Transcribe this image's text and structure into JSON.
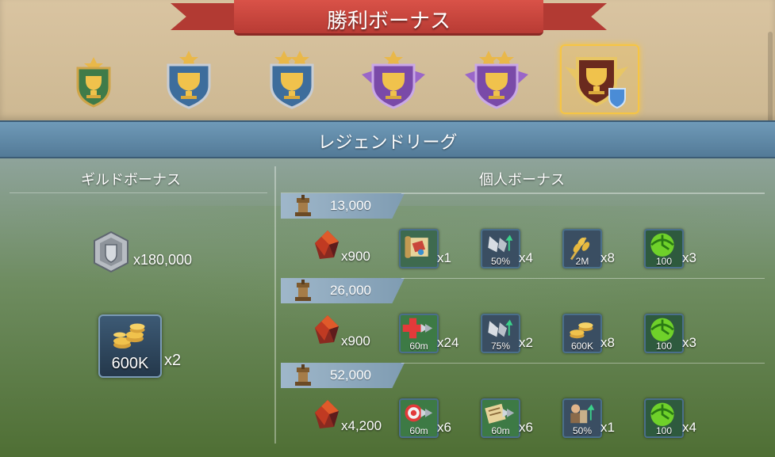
{
  "title": "勝利ボーナス",
  "league_name": "レジェンドリーグ",
  "guild_header": "ギルドボーナス",
  "personal_header": "個人ボーナス",
  "badges": [
    {
      "name": "badge-green-1star",
      "stars": 1
    },
    {
      "name": "badge-blue-1star",
      "stars": 1
    },
    {
      "name": "badge-blue-2star",
      "stars": 2
    },
    {
      "name": "badge-purple-1star",
      "stars": 1
    },
    {
      "name": "badge-purple-2star",
      "stars": 2
    },
    {
      "name": "badge-legend",
      "stars": 0,
      "selected": true
    }
  ],
  "guild_rewards": [
    {
      "icon": "guild-coin-icon",
      "qty": "x180,000"
    },
    {
      "icon": "gold-pile-icon",
      "overlay": "600K",
      "qty": "x2"
    }
  ],
  "tiers": [
    {
      "threshold": "13,000",
      "gem_qty": "x900",
      "items": [
        {
          "icon": "scroll-map-icon",
          "overlay": "",
          "qty": "x1",
          "color": "#3e6a4f"
        },
        {
          "icon": "troop-boost-icon",
          "overlay": "50%",
          "qty": "x4",
          "color": "#3a4e62"
        },
        {
          "icon": "grain-icon",
          "overlay": "2M",
          "qty": "x8",
          "color": "#3a4e62"
        },
        {
          "icon": "speedup-icon",
          "overlay": "100",
          "qty": "x3",
          "color": "#2e5a3e"
        }
      ]
    },
    {
      "threshold": "26,000",
      "gem_qty": "x900",
      "items": [
        {
          "icon": "healing-speedup-icon",
          "overlay": "60m",
          "qty": "x24",
          "color": "#3d7a45"
        },
        {
          "icon": "troop-boost-icon",
          "overlay": "75%",
          "qty": "x2",
          "color": "#3a4e62"
        },
        {
          "icon": "gold-icon",
          "overlay": "600K",
          "qty": "x8",
          "color": "#3a4e62"
        },
        {
          "icon": "speedup-icon",
          "overlay": "100",
          "qty": "x3",
          "color": "#2e5a3e"
        }
      ]
    },
    {
      "threshold": "52,000",
      "gem_qty": "x4,200",
      "items": [
        {
          "icon": "target-speedup-icon",
          "overlay": "60m",
          "qty": "x6",
          "color": "#3d7a45"
        },
        {
          "icon": "research-speedup-icon",
          "overlay": "60m",
          "qty": "x6",
          "color": "#3d7a45"
        },
        {
          "icon": "worker-boost-icon",
          "overlay": "50%",
          "qty": "x1",
          "color": "#3a4e62"
        },
        {
          "icon": "speedup-icon",
          "overlay": "100",
          "qty": "x4",
          "color": "#2e5a3e"
        }
      ]
    }
  ]
}
